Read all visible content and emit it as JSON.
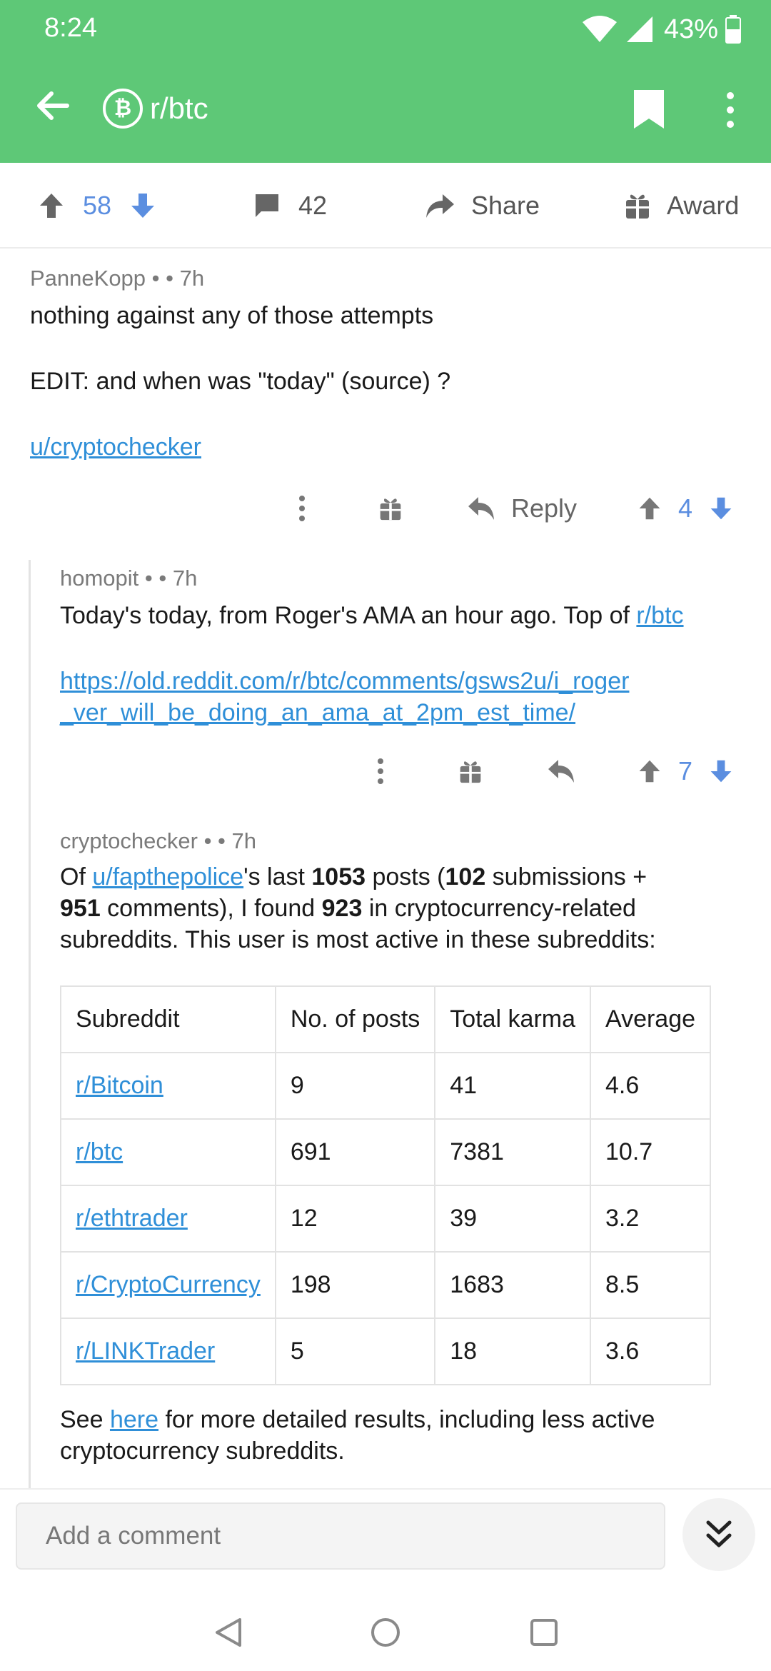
{
  "status_bar": {
    "time": "8:24",
    "battery": "43%"
  },
  "app_bar": {
    "subreddit": "r/btc",
    "logo_glyph": "₿"
  },
  "post_actions": {
    "score": "58",
    "comments": "42",
    "share": "Share",
    "award": "Award"
  },
  "comments": [
    {
      "author": "PanneKopp",
      "age": "7h",
      "lines": [
        "nothing against any of those attempts",
        "EDIT: and when was \"today\" (source) ?"
      ],
      "link": "u/cryptochecker",
      "reply_label": "Reply",
      "score": "4"
    },
    {
      "author": "homopit",
      "age": "7h",
      "text_prefix": "Today's today, from Roger's AMA an hour ago. Top of ",
      "sub_link": "r/btc",
      "url_line1": "https://old.reddit.com/r/btc/comments/gsws2u/i_roger",
      "url_line2": "_ver_will_be_doing_an_ama_at_2pm_est_time/",
      "score": "7"
    },
    {
      "author": "cryptochecker",
      "age": "7h",
      "p1": "Of ",
      "user_link": "u/fapthepolice",
      "p2": "'s last ",
      "n_posts": "1053",
      "p3": " posts (",
      "n_subs": "102",
      "p4": " submissions +",
      "n_comments": "951",
      "p5": " comments), I found ",
      "n_found": "923",
      "p6": " in cryptocurrency-related",
      "p7": "subreddits. This user is most active in these subreddits:",
      "table": {
        "headers": [
          "Subreddit",
          "No. of posts",
          "Total karma",
          "Average"
        ],
        "rows": [
          [
            "r/Bitcoin",
            "9",
            "41",
            "4.6"
          ],
          [
            "r/btc",
            "691",
            "7381",
            "10.7"
          ],
          [
            "r/ethtrader",
            "12",
            "39",
            "3.2"
          ],
          [
            "r/CryptoCurrency",
            "198",
            "1683",
            "8.5"
          ],
          [
            "r/LINKTrader",
            "5",
            "18",
            "3.6"
          ]
        ]
      },
      "footer_prefix": "See ",
      "footer_link": "here",
      "footer_suffix": " for more detailed results, including less active",
      "footer_line2": "cryptocurrency subreddits."
    }
  ],
  "composer": {
    "placeholder": "Add a comment"
  },
  "colors": {
    "brand_green": "#5ec877",
    "vote_blue": "#5b8ee0",
    "link_blue": "#2f8fd8"
  }
}
